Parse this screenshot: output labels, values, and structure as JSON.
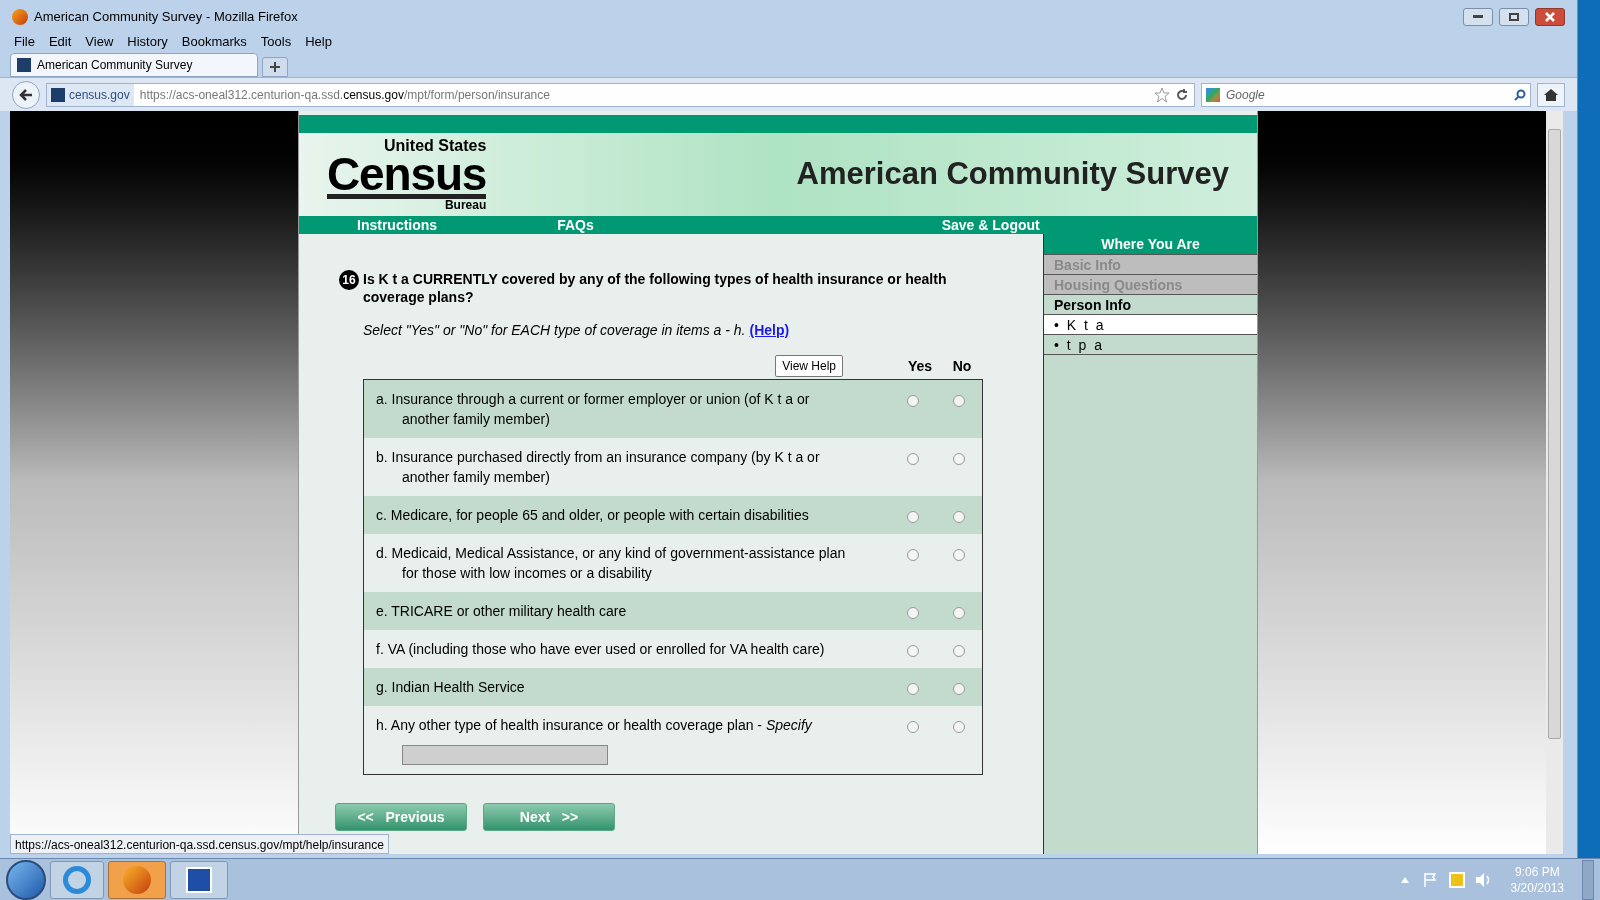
{
  "window": {
    "title": "American Community Survey - Mozilla Firefox"
  },
  "menu": [
    "File",
    "Edit",
    "View",
    "History",
    "Bookmarks",
    "Tools",
    "Help"
  ],
  "tabs": [
    {
      "label": "American Community Survey",
      "selected": true
    }
  ],
  "address": {
    "site": "census.gov",
    "url_prefix": "https://acs-oneal312.centurion-qa.ssd.",
    "url_domain": "census.gov",
    "url_path": "/mpt/form/person/insurance"
  },
  "search": {
    "placeholder": "Google"
  },
  "page": {
    "logo": {
      "top": "United States",
      "main": "Census",
      "bottom": "Bureau"
    },
    "banner_title": "American Community Survey",
    "nav": [
      "Instructions",
      "FAQs",
      "Save & Logout"
    ],
    "question": {
      "number": "16",
      "text": "Is K t a CURRENTLY covered by any of the following types of health insurance or health coverage plans?",
      "instruction": "Select \"Yes\" or \"No\" for EACH type of coverage in items a - h.",
      "help_link": "(Help)",
      "view_help": "View Help",
      "columns": [
        "Yes",
        "No"
      ],
      "items": [
        {
          "text": "a. Insurance through a current or former employer or union (of K t a or another family member)",
          "yes": false,
          "no": false
        },
        {
          "text": "b. Insurance purchased directly from an insurance company (by K t a or another family member)",
          "yes": false,
          "no": false
        },
        {
          "text": "c. Medicare, for people 65 and older, or people with certain disabilities",
          "yes": false,
          "no": false
        },
        {
          "text": "d. Medicaid, Medical Assistance, or any kind of government-assistance plan for those with low incomes or a disability",
          "yes": false,
          "no": false
        },
        {
          "text": "e. TRICARE or other military health care",
          "yes": false,
          "no": false
        },
        {
          "text": "f. VA (including those who have ever used or enrolled for VA health care)",
          "yes": false,
          "no": false
        },
        {
          "text": "g. Indian Health Service",
          "yes": false,
          "no": false
        },
        {
          "text": "h. Any other type of health insurance or health coverage plan - *Specify*",
          "yes": false,
          "no": false,
          "specify": true
        }
      ]
    },
    "buttons": [
      "<<   Previous",
      "Next   >>"
    ],
    "sidebar": {
      "title": "Where You Are",
      "items": [
        {
          "label": "Basic Info",
          "kind": "done",
          "selected": false
        },
        {
          "label": "Housing Questions",
          "kind": "done",
          "selected": false
        },
        {
          "label": "Person Info",
          "kind": "section",
          "selected": false
        },
        {
          "label": "• K t a",
          "kind": "person",
          "selected": true
        },
        {
          "label": "• t p a",
          "kind": "person",
          "selected": false
        }
      ]
    }
  },
  "status_bar": {
    "link": "https://acs-oneal312.centurion-qa.ssd.census.gov/mpt/help/insurance"
  },
  "clock": {
    "time": "9:06 PM",
    "date": "3/20/2013"
  }
}
